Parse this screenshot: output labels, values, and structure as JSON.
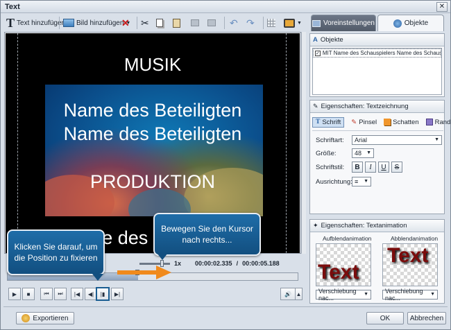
{
  "window": {
    "title": "Text",
    "close_glyph": "✕"
  },
  "toolbar": {
    "add_text_label": "Text hinzufügen",
    "add_image_label": "Bild hinzufügen"
  },
  "tabs": [
    {
      "label": "Voreinstellungen"
    },
    {
      "label": "Objekte"
    }
  ],
  "stage": {
    "line_top": "MUSIK",
    "line1": "Name des Beteiligten",
    "line2": "Name des Beteiligten",
    "line3": "PRODUKTION",
    "line_bottom": "Name des Darstellers"
  },
  "transport": {
    "speed": "1x",
    "time_current": "00:00:02.335",
    "time_total": "00:00:05.188",
    "time_sep": "/"
  },
  "timeline": {
    "progress_fraction": 0.45
  },
  "objects_panel": {
    "header": "Objekte",
    "items": [
      {
        "checked": true,
        "label": "MIT  Name des Schauspielers Name des Schauspieler..."
      }
    ]
  },
  "text_props": {
    "header": "Eigenschaften: Textzeichnung",
    "tabs": [
      {
        "label": "Schrift"
      },
      {
        "label": "Pinsel"
      },
      {
        "label": "Schatten"
      },
      {
        "label": "Rand"
      }
    ],
    "font_label": "Schriftart:",
    "font_value": "Arial",
    "size_label": "Größe:",
    "size_value": "48",
    "style_label": "Schriftstil:",
    "style_buttons": [
      "B",
      "I",
      "U",
      "S"
    ],
    "align_label": "Ausrichtung:",
    "align_value": "≡"
  },
  "animation": {
    "header": "Eigenschaften: Textanimation",
    "in_label": "Aufblendanimation",
    "out_label": "Abblendanimation",
    "preview_text": "Text",
    "in_value": "Verschiebung nac...",
    "out_value": "Verschiebung nac..."
  },
  "footer": {
    "export_label": "Exportieren",
    "ok_label": "OK",
    "cancel_label": "Abbrechen"
  },
  "callouts": {
    "fix_position": "Klicken Sie darauf, um die Position zu fixieren",
    "move_cursor": "Bewegen Sie den Kursor nach rechts..."
  },
  "colors": {
    "accent_blue": "#1a5d92",
    "arrow_orange": "#f08a1c",
    "text_red": "#7a0c0c"
  }
}
